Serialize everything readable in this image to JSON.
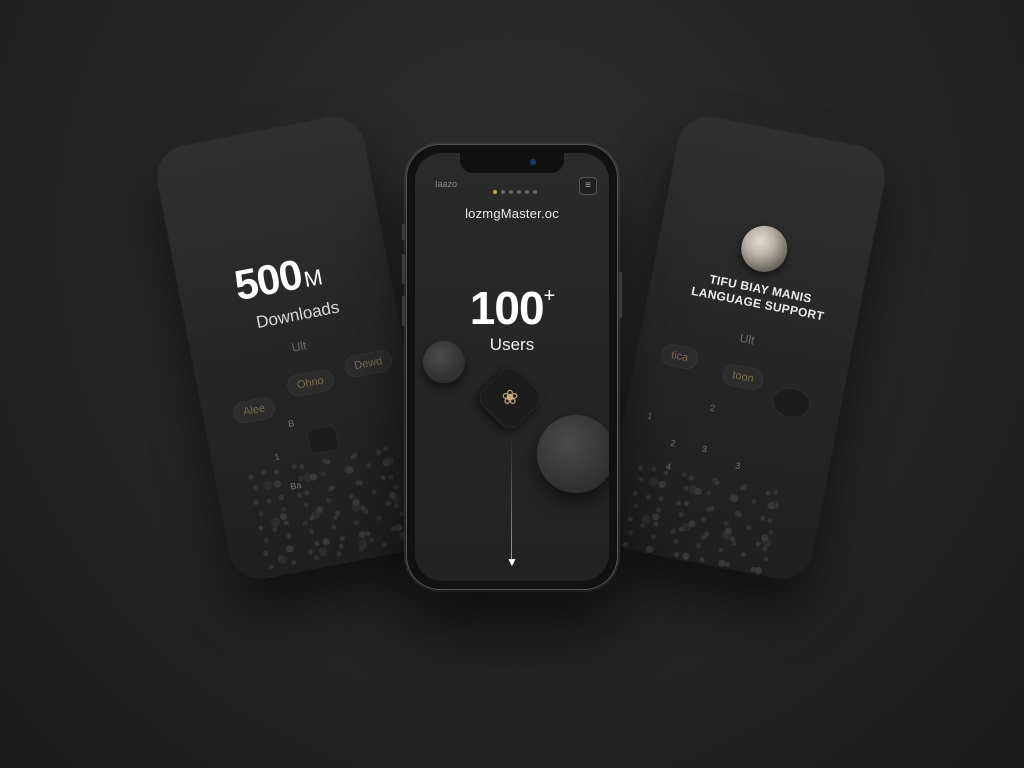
{
  "left_card": {
    "stat_value": "500",
    "stat_suffix": "M",
    "stat_label": "Downloads",
    "faint_label": "Ult",
    "chips": [
      "Ohno",
      "Dewd",
      "Alee"
    ],
    "keys": [
      "B",
      "1",
      "Ba"
    ]
  },
  "phone": {
    "status_left": "Iaazo",
    "menu_icon": "menu-icon",
    "brand": "lozmgMaster.oc",
    "hero_value": "100",
    "hero_suffix": "+",
    "hero_label": "Users",
    "page_dots": {
      "count": 6,
      "active_index": 0
    },
    "accent_color": "#c9a24a"
  },
  "right_card": {
    "title_line1": "TIFU BIAY MANIS",
    "title_line2": "LANGUAGE SUPPORT",
    "faint_label": "Ult",
    "chips": [
      "tica",
      "toon"
    ],
    "keys": [
      "2",
      "1",
      "2",
      "3",
      "3",
      "4"
    ]
  }
}
